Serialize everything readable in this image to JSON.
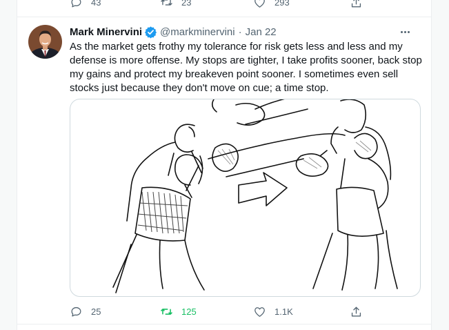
{
  "previous_tweet": {
    "reply_count": "43",
    "retweet_count": "23",
    "like_count": "293"
  },
  "tweet": {
    "author_name": "Mark Minervini",
    "handle": "@markminervini",
    "separator": "·",
    "date": "Jan 22",
    "text": "As the market gets frothy my tolerance for risk gets less and less and my defense is more offense. My stops are tighter, I take profits sooner, back stop my gains and protect my breakeven point sooner. I sometimes even sell stocks just because they don't move on cue; a time stop.",
    "reply_count": "25",
    "retweet_count": "125",
    "like_count": "1.1K",
    "retweeted": true
  },
  "colors": {
    "verified_badge": "#1d9bf0",
    "retweet_active": "#17bf63",
    "secondary_text": "#536471"
  },
  "icons": [
    "reply-icon",
    "retweet-icon",
    "like-icon",
    "share-icon",
    "verified-badge-icon",
    "more-icon"
  ]
}
